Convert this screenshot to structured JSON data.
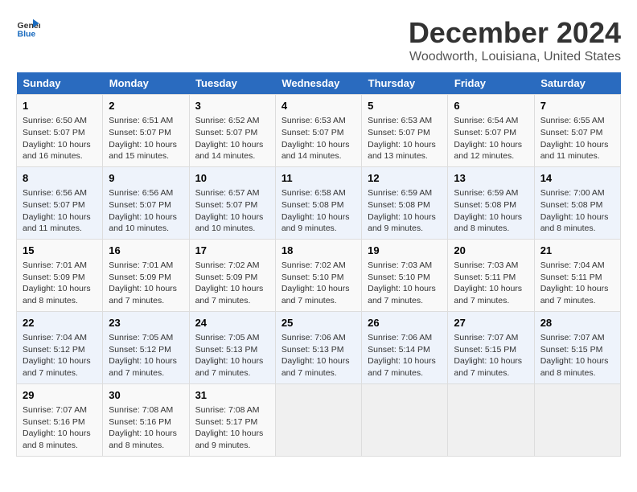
{
  "logo": {
    "text_general": "General",
    "text_blue": "Blue",
    "icon_unicode": "▶"
  },
  "title": "December 2024",
  "subtitle": "Woodworth, Louisiana, United States",
  "days_of_week": [
    "Sunday",
    "Monday",
    "Tuesday",
    "Wednesday",
    "Thursday",
    "Friday",
    "Saturday"
  ],
  "weeks": [
    [
      {
        "day": "1",
        "info": "Sunrise: 6:50 AM\nSunset: 5:07 PM\nDaylight: 10 hours\nand 16 minutes."
      },
      {
        "day": "2",
        "info": "Sunrise: 6:51 AM\nSunset: 5:07 PM\nDaylight: 10 hours\nand 15 minutes."
      },
      {
        "day": "3",
        "info": "Sunrise: 6:52 AM\nSunset: 5:07 PM\nDaylight: 10 hours\nand 14 minutes."
      },
      {
        "day": "4",
        "info": "Sunrise: 6:53 AM\nSunset: 5:07 PM\nDaylight: 10 hours\nand 14 minutes."
      },
      {
        "day": "5",
        "info": "Sunrise: 6:53 AM\nSunset: 5:07 PM\nDaylight: 10 hours\nand 13 minutes."
      },
      {
        "day": "6",
        "info": "Sunrise: 6:54 AM\nSunset: 5:07 PM\nDaylight: 10 hours\nand 12 minutes."
      },
      {
        "day": "7",
        "info": "Sunrise: 6:55 AM\nSunset: 5:07 PM\nDaylight: 10 hours\nand 11 minutes."
      }
    ],
    [
      {
        "day": "8",
        "info": "Sunrise: 6:56 AM\nSunset: 5:07 PM\nDaylight: 10 hours\nand 11 minutes."
      },
      {
        "day": "9",
        "info": "Sunrise: 6:56 AM\nSunset: 5:07 PM\nDaylight: 10 hours\nand 10 minutes."
      },
      {
        "day": "10",
        "info": "Sunrise: 6:57 AM\nSunset: 5:07 PM\nDaylight: 10 hours\nand 10 minutes."
      },
      {
        "day": "11",
        "info": "Sunrise: 6:58 AM\nSunset: 5:08 PM\nDaylight: 10 hours\nand 9 minutes."
      },
      {
        "day": "12",
        "info": "Sunrise: 6:59 AM\nSunset: 5:08 PM\nDaylight: 10 hours\nand 9 minutes."
      },
      {
        "day": "13",
        "info": "Sunrise: 6:59 AM\nSunset: 5:08 PM\nDaylight: 10 hours\nand 8 minutes."
      },
      {
        "day": "14",
        "info": "Sunrise: 7:00 AM\nSunset: 5:08 PM\nDaylight: 10 hours\nand 8 minutes."
      }
    ],
    [
      {
        "day": "15",
        "info": "Sunrise: 7:01 AM\nSunset: 5:09 PM\nDaylight: 10 hours\nand 8 minutes."
      },
      {
        "day": "16",
        "info": "Sunrise: 7:01 AM\nSunset: 5:09 PM\nDaylight: 10 hours\nand 7 minutes."
      },
      {
        "day": "17",
        "info": "Sunrise: 7:02 AM\nSunset: 5:09 PM\nDaylight: 10 hours\nand 7 minutes."
      },
      {
        "day": "18",
        "info": "Sunrise: 7:02 AM\nSunset: 5:10 PM\nDaylight: 10 hours\nand 7 minutes."
      },
      {
        "day": "19",
        "info": "Sunrise: 7:03 AM\nSunset: 5:10 PM\nDaylight: 10 hours\nand 7 minutes."
      },
      {
        "day": "20",
        "info": "Sunrise: 7:03 AM\nSunset: 5:11 PM\nDaylight: 10 hours\nand 7 minutes."
      },
      {
        "day": "21",
        "info": "Sunrise: 7:04 AM\nSunset: 5:11 PM\nDaylight: 10 hours\nand 7 minutes."
      }
    ],
    [
      {
        "day": "22",
        "info": "Sunrise: 7:04 AM\nSunset: 5:12 PM\nDaylight: 10 hours\nand 7 minutes."
      },
      {
        "day": "23",
        "info": "Sunrise: 7:05 AM\nSunset: 5:12 PM\nDaylight: 10 hours\nand 7 minutes."
      },
      {
        "day": "24",
        "info": "Sunrise: 7:05 AM\nSunset: 5:13 PM\nDaylight: 10 hours\nand 7 minutes."
      },
      {
        "day": "25",
        "info": "Sunrise: 7:06 AM\nSunset: 5:13 PM\nDaylight: 10 hours\nand 7 minutes."
      },
      {
        "day": "26",
        "info": "Sunrise: 7:06 AM\nSunset: 5:14 PM\nDaylight: 10 hours\nand 7 minutes."
      },
      {
        "day": "27",
        "info": "Sunrise: 7:07 AM\nSunset: 5:15 PM\nDaylight: 10 hours\nand 7 minutes."
      },
      {
        "day": "28",
        "info": "Sunrise: 7:07 AM\nSunset: 5:15 PM\nDaylight: 10 hours\nand 8 minutes."
      }
    ],
    [
      {
        "day": "29",
        "info": "Sunrise: 7:07 AM\nSunset: 5:16 PM\nDaylight: 10 hours\nand 8 minutes."
      },
      {
        "day": "30",
        "info": "Sunrise: 7:08 AM\nSunset: 5:16 PM\nDaylight: 10 hours\nand 8 minutes."
      },
      {
        "day": "31",
        "info": "Sunrise: 7:08 AM\nSunset: 5:17 PM\nDaylight: 10 hours\nand 9 minutes."
      },
      {
        "day": "",
        "info": ""
      },
      {
        "day": "",
        "info": ""
      },
      {
        "day": "",
        "info": ""
      },
      {
        "day": "",
        "info": ""
      }
    ]
  ]
}
